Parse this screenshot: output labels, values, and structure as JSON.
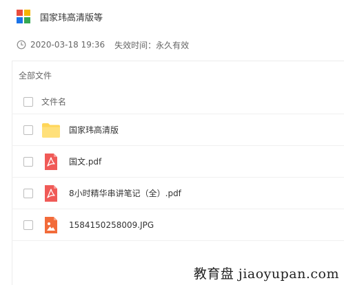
{
  "header": {
    "title": "国家玮高清版等",
    "logo_colors": [
      "#e84c3d",
      "#f4b400",
      "#1a73e8",
      "#34a853"
    ]
  },
  "meta": {
    "date": "2020-03-18 19:36",
    "expire_label": "失效时间：",
    "expire_value": "永久有效"
  },
  "breadcrumb": "全部文件",
  "table": {
    "column_name": "文件名",
    "files": [
      {
        "name": "国家玮高清版",
        "icon": "folder-icon",
        "color": "#ffd659"
      },
      {
        "name": "国文.pdf",
        "icon": "pdf-icon",
        "color": "#f05a57"
      },
      {
        "name": "8小时精华串讲笔记（全）.pdf",
        "icon": "pdf-icon",
        "color": "#f05a57"
      },
      {
        "name": "1584150258009.JPG",
        "icon": "image-icon",
        "color": "#f26b3a"
      }
    ]
  },
  "watermark": "教育盘 jiaoyupan.com"
}
